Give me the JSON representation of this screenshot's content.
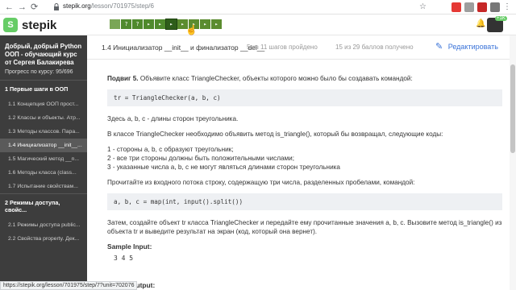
{
  "browser": {
    "url_host": "stepik.org",
    "url_path": "/lesson/701975/step/6",
    "back": "←",
    "forward": "→",
    "reload": "⟳",
    "star": "☆"
  },
  "topbar": {
    "logo_text": "stepik",
    "logo_mark": "S",
    "badge": "+1K",
    "steps": [
      "",
      "?",
      "?",
      "▸",
      "▸",
      "▸",
      "▸",
      "▸",
      "▸",
      "▸"
    ]
  },
  "sidebar": {
    "course_title": "Добрый, добрый Python ООП - обучающий курс от Сергея Балакирева",
    "progress_label": "Прогресс по курсу:",
    "progress_value": "95/696",
    "sections": [
      {
        "title": "1  Первые шаги в ООП",
        "lessons": [
          "1.1  Концепция ООП прост...",
          "1.2  Классы и объекты. Атр...",
          "1.3  Методы классов. Пара...",
          "1.4  Инициализатор __init__...",
          "1.5  Магический метод __n...",
          "1.6  Методы класса (class...",
          "1.7  Испытание свойствам..."
        ]
      },
      {
        "title": "2  Режимы доступа, свойс...",
        "lessons": [
          "2.1  Режимы доступа public...",
          "2.2  Свойства property. Дек..."
        ]
      }
    ]
  },
  "lesson_header": {
    "title": "1.4 Инициализатор __init__ и финализатор __del__",
    "steps_done": "5 из 11 шагов пройдено",
    "points": "15 из 29 баллов  получено",
    "edit_label": "Редактировать"
  },
  "content": {
    "task_bold": "Подвиг 5.",
    "task_text": " Объявите класс TriangleChecker, объекты которого можно было бы создавать командой:",
    "code1": "tr = TriangleChecker(a, b, c)",
    "p1": "Здесь a, b, c - длины сторон треугольника.",
    "p2": "В классе TriangleChecker необходимо объявить метод is_triangle(), который бы возвращал, следующие коды:",
    "list": [
      "1 - стороны a, b, c образуют треугольник;",
      "2 - все три стороны должны быть положительными числами;",
      "3 - указанные числа a, b, c не могут являться длинами сторон треугольника"
    ],
    "p3": "Прочитайте из входного потока строку, содержащую три числа, разделенных пробелами, командой:",
    "code2": "a, b, c = map(int, input().split())",
    "p4": "Затем, создайте объект tr класса TriangleChecker и передайте ему прочитанные значения a, b, c. Вызовите метод is_triangle() из объекта tr и выведите результат на экран (код, который она вернет).",
    "sample_input_label": "Sample Input:",
    "sample_input_value": "3 4 5",
    "sample_output_label": "Output:"
  },
  "statusbar": {
    "url": "https://stepik.org/lesson/701975/step/7?unit=702076"
  },
  "colors": {
    "sidebar_bg": "#3d3d3d",
    "step_green": "#5b8c2f",
    "edit_blue": "#3a73d8",
    "logo_green": "#66cc66"
  }
}
